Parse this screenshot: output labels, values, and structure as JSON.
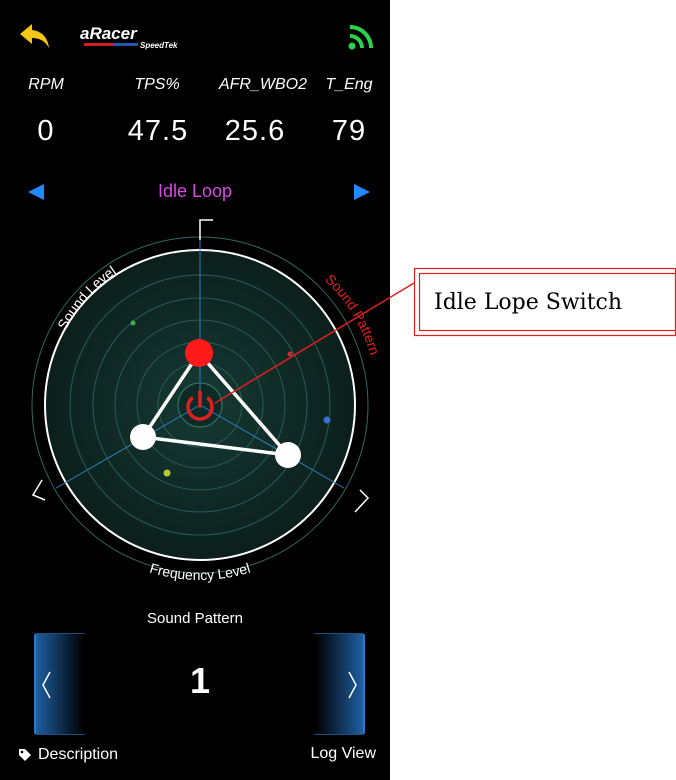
{
  "header": {
    "back_icon": "back-arrow-icon",
    "logo_main": "aRacer",
    "logo_sub": "SpeedTek",
    "signal_icon": "wifi-signal-icon",
    "accent_color": "#f5c518",
    "signal_color": "#2bd24a"
  },
  "metrics": [
    {
      "label": "RPM",
      "value": "0"
    },
    {
      "label": "TPS%",
      "value": "47.5"
    },
    {
      "label": "AFR_WBO2",
      "value": "25.6"
    },
    {
      "label": "T_Eng",
      "value": "79"
    }
  ],
  "mode": {
    "title": "Idle Loop",
    "title_color": "#d64be0",
    "arrow_color": "#1f8bff"
  },
  "radar": {
    "axis_sound_level": "Sound Level",
    "axis_sound_pattern": "Sound Pattern",
    "axis_frequency_level": "Frequency Level",
    "power_icon": "power-icon",
    "power_color": "#e02020",
    "active_dot_color": "#ff1a1a"
  },
  "pattern": {
    "label": "Sound Pattern",
    "value": "1",
    "prev_icon": "chevron-left-icon",
    "next_icon": "chevron-right-icon"
  },
  "footer": {
    "description_label": "Description",
    "description_icon": "tag-icon",
    "log_view_label": "Log View"
  },
  "annotation": {
    "text": "Idle Lope Switch",
    "line_color": "#e02020"
  }
}
